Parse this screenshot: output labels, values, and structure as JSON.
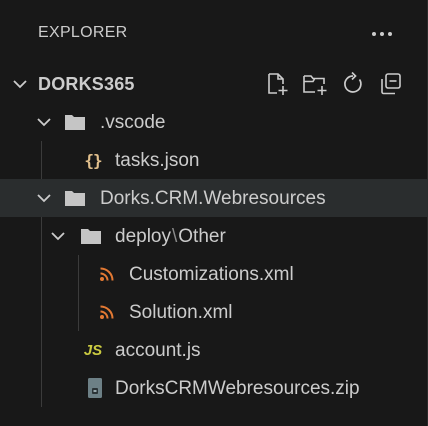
{
  "header": {
    "title": "EXPLORER",
    "more_icon": "ellipsis-icon"
  },
  "root": {
    "label": "DORKS365",
    "actions": [
      {
        "name": "new-file-button",
        "icon": "new-file-icon"
      },
      {
        "name": "new-folder-button",
        "icon": "new-folder-icon"
      },
      {
        "name": "refresh-button",
        "icon": "refresh-icon"
      },
      {
        "name": "collapse-all-button",
        "icon": "collapse-all-icon"
      }
    ]
  },
  "tree": {
    "vscode_folder": ".vscode",
    "tasks_file": "tasks.json",
    "webresources_folder": "Dorks.CRM.Webresources",
    "deploy_folder": "deploy",
    "deploy_separator": "\\",
    "other_folder": "Other",
    "customizations_file": "Customizations.xml",
    "solution_file": "Solution.xml",
    "account_file": "account.js",
    "zip_file": "DorksCRMWebresources.zip"
  },
  "colors": {
    "background": "#181818",
    "selected_row": "#2a2d2e",
    "text": "#cccccc",
    "json_icon": "#e2c08d",
    "js_icon": "#cbcb41",
    "xml_icon": "#e37933"
  }
}
